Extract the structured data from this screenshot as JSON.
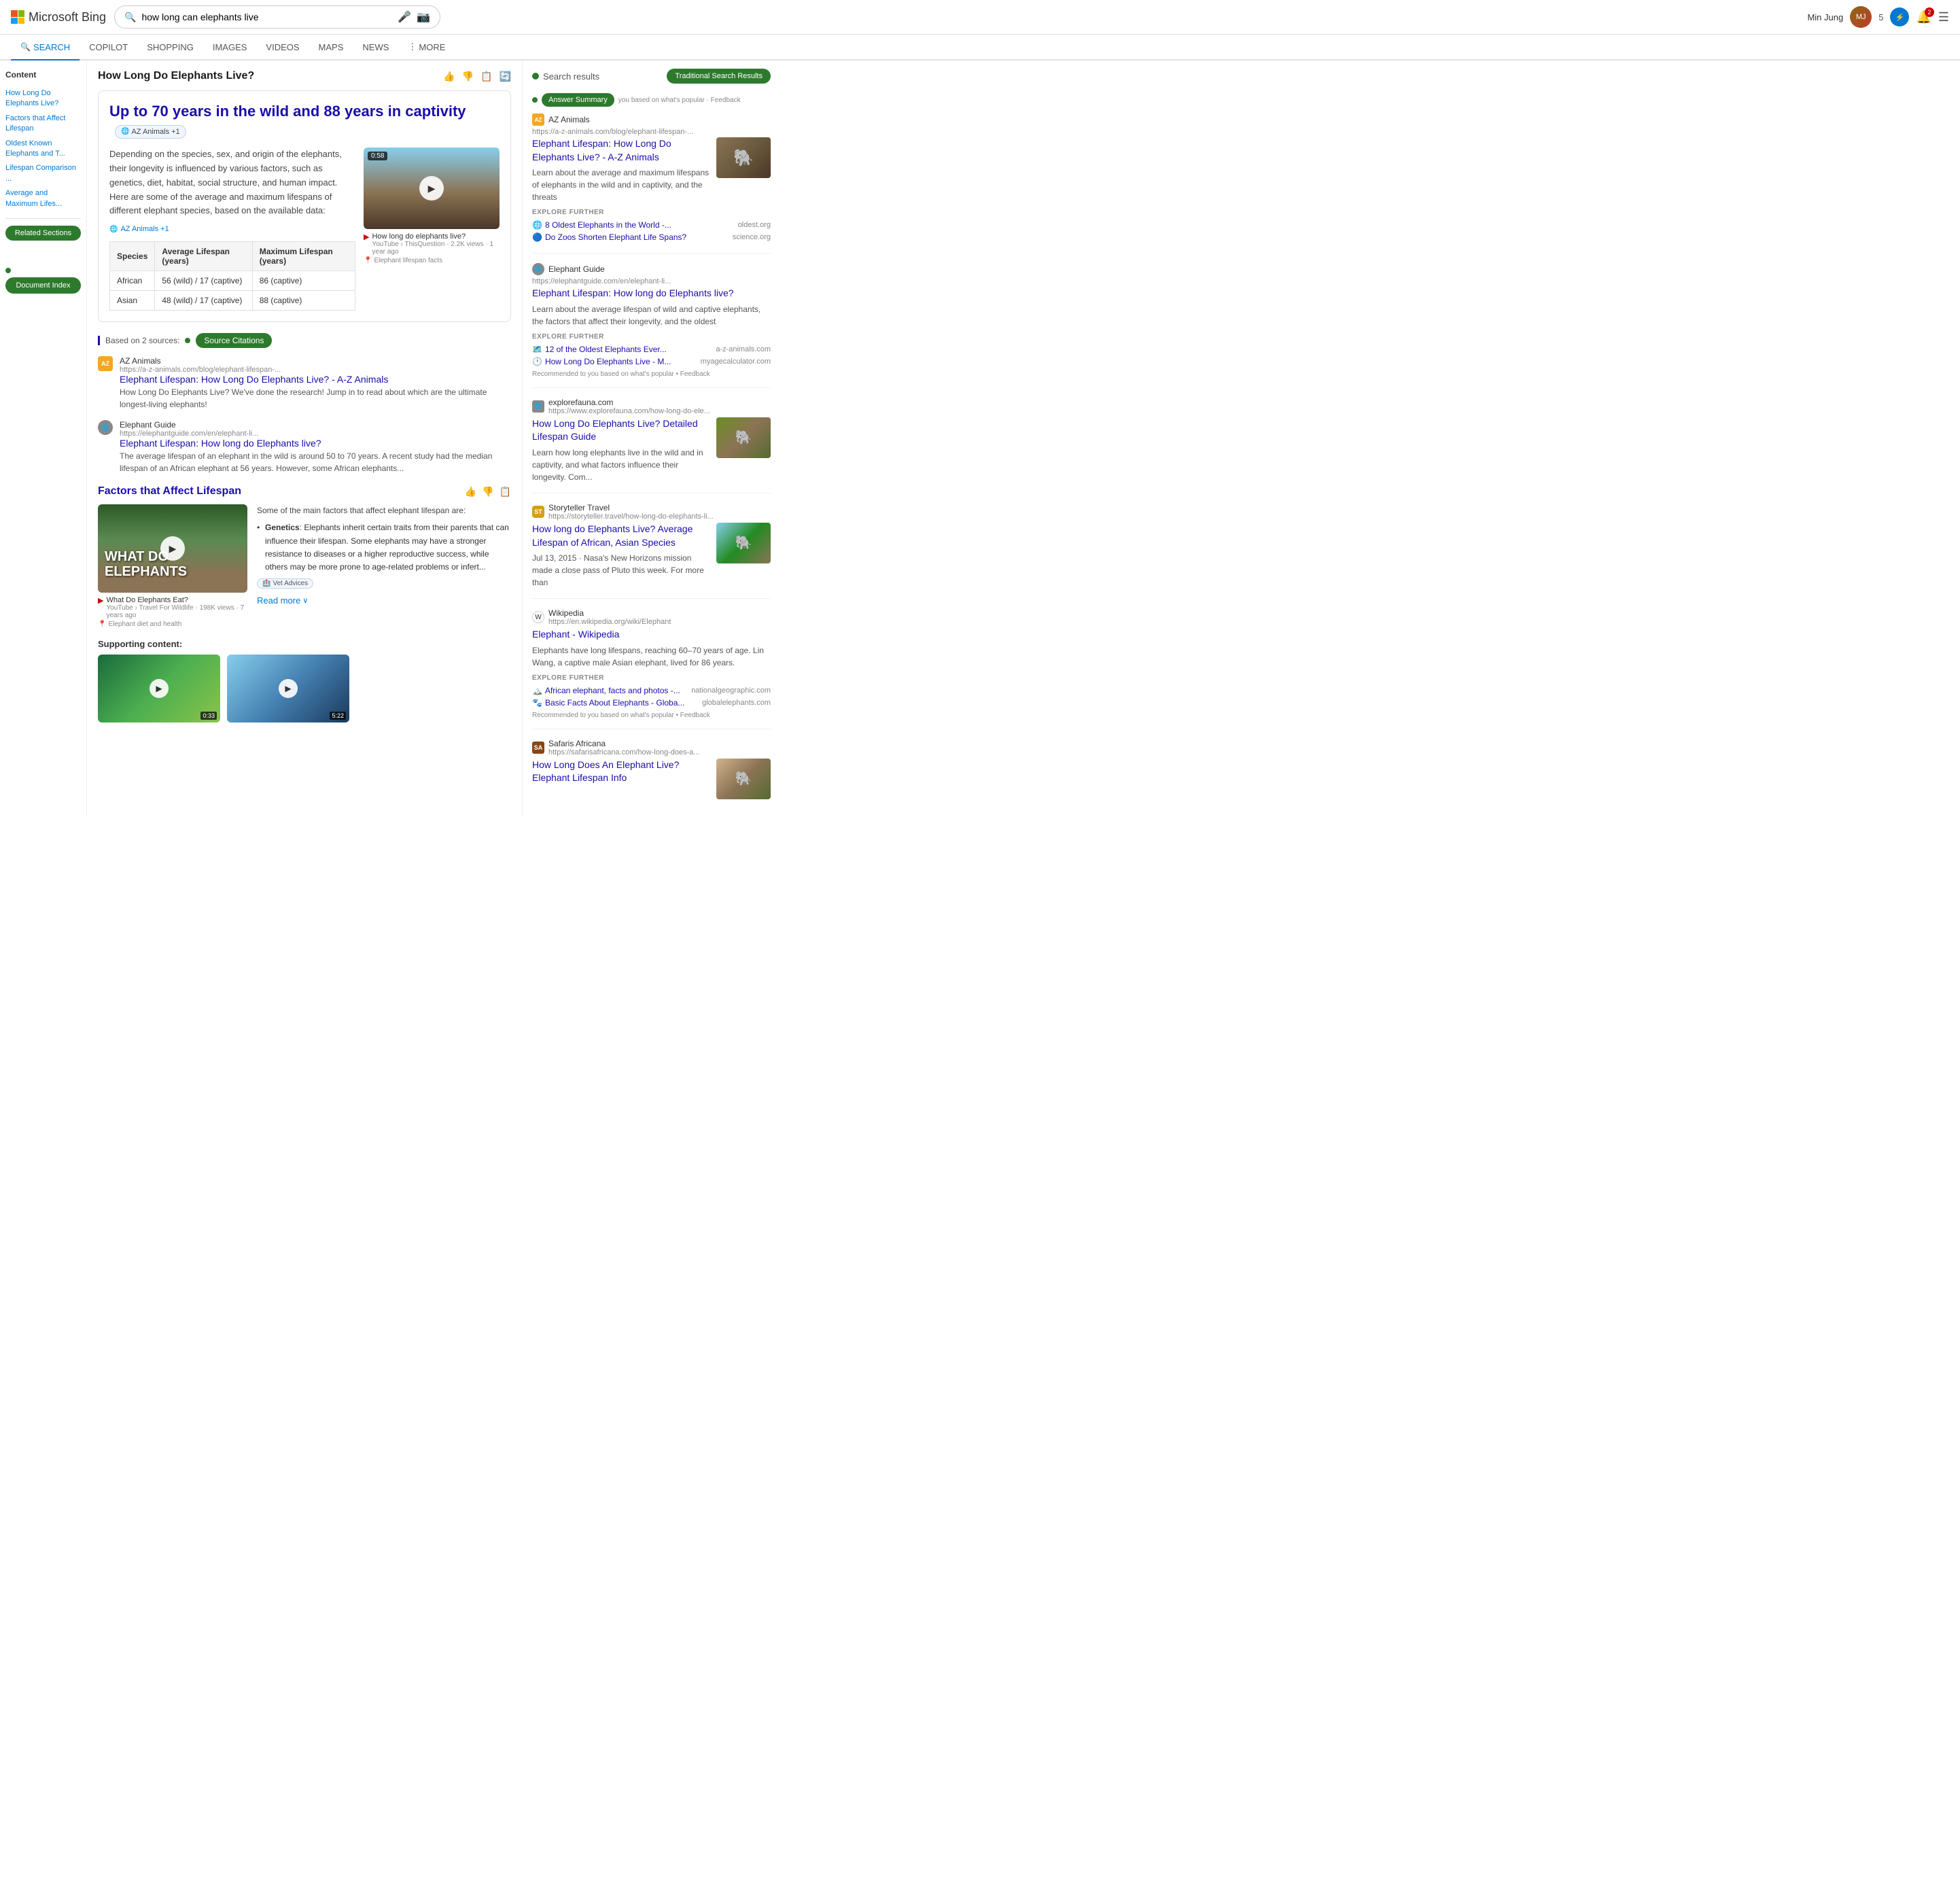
{
  "header": {
    "logo_text": "Microsoft Bing",
    "search_query": "how long can elephants live",
    "user_name": "Min Jung",
    "user_points": "5",
    "notif_count": "2"
  },
  "nav": {
    "tabs": [
      {
        "id": "search",
        "label": "SEARCH",
        "active": true
      },
      {
        "id": "copilot",
        "label": "COPILOT",
        "active": false
      },
      {
        "id": "shopping",
        "label": "SHOPPING",
        "active": false
      },
      {
        "id": "images",
        "label": "IMAGES",
        "active": false
      },
      {
        "id": "videos",
        "label": "VIDEOS",
        "active": false
      },
      {
        "id": "maps",
        "label": "MAPS",
        "active": false
      },
      {
        "id": "news",
        "label": "NEWS",
        "active": false
      },
      {
        "id": "more",
        "label": "MORE",
        "active": false
      }
    ]
  },
  "sidebar": {
    "title": "Content",
    "items": [
      {
        "label": "How Long Do Elephants Live?"
      },
      {
        "label": "Factors that Affect Lifespan"
      },
      {
        "label": "Oldest Known Elephants and T..."
      },
      {
        "label": "Lifespan Comparison ..."
      },
      {
        "label": "Average and Maximum Lifes..."
      }
    ],
    "doc_index_btn": "Document Index"
  },
  "main": {
    "page_title": "How Long Do Elephants Live?",
    "answer_headline": "Up to 70 years in the wild and 88 years in captivity",
    "source_badge": "AZ Animals +1",
    "answer_body_text": "Depending on the species, sex, and origin of the elephants, their longevity is influenced by various factors, such as genetics, diet, habitat, social structure, and human impact. Here are some of the average and maximum lifespans of different elephant species, based on the available data:",
    "answer_source_link": "AZ Animals +1",
    "video": {
      "duration": "0:58",
      "title": "How long do elephants live?",
      "channel": "YouTube › ThisQuestion",
      "views": "2.2K views",
      "time_ago": "1 year ago",
      "location_label": "Elephant lifespan facts"
    },
    "table": {
      "headers": [
        "Species",
        "Average Lifespan (years)",
        "Maximum Lifespan (years)"
      ],
      "rows": [
        [
          "African",
          "56 (wild) / 17 (captive)",
          "86 (captive)"
        ],
        [
          "Asian",
          "48 (wild) / 17 (captive)",
          "88 (captive)"
        ]
      ]
    },
    "sources_label": "Based on 2 sources:",
    "source_citations_btn": "Source Citations",
    "sources": [
      {
        "site": "AZ Animals",
        "url": "https://a-z-animals.com/blog/elephant-lifespan-...",
        "title": "Elephant Lifespan: How Long Do Elephants Live? - A-Z Animals",
        "desc": "How Long Do Elephants Live? We've done the research! Jump in to read about which are the ultimate longest-living elephants!"
      },
      {
        "site": "Elephant Guide",
        "url": "https://elephantguide.com/en/elephant-li...",
        "title": "Elephant Lifespan: How long do Elephants live?",
        "desc": "The average lifespan of an elephant in the wild is around 50 to 70 years. A recent study had the median lifespan of an African elephant at 56 years. However, some African elephants..."
      }
    ],
    "factors_section": {
      "title": "Factors that Affect Lifespan",
      "video": {
        "title": "WHAT DO ELEPHANTS",
        "subtitle": "What Do Elephants Eat?",
        "channel": "YouTube › Travel For Wildlife",
        "views": "198K views",
        "time_ago": "7 years ago",
        "location_label": "Elephant diet and health"
      },
      "intro": "Some of the main factors that affect elephant lifespan are:",
      "bullets": [
        {
          "term": "Genetics",
          "text": "Elephants inherit certain traits from their parents that can influence their lifespan. Some elephants may have a stronger resistance to diseases or a higher reproductive success, while others may be more prone to age-related problems or infert..."
        }
      ],
      "vet_badge": "Vet Advices",
      "read_more": "Read more"
    },
    "supporting_title": "Supporting content:",
    "mini_videos": [
      {
        "duration": "0:33"
      },
      {
        "duration": "5:22"
      }
    ]
  },
  "tsr": {
    "label": "Search results",
    "badge": "Traditional Search Results",
    "results": [
      {
        "site": "AZ Animals",
        "url": "https://a-z-animals.com/blog/elephant-lifespan-...",
        "title": "Elephant Lifespan: How Long Do Elephants Live? - A-Z Animals",
        "desc": "Learn about the average and maximum lifespans of elephants in the wild and in captivity, and the threats",
        "has_thumb": true,
        "explore_further": [
          {
            "label": "8 Oldest Elephants in the World -...",
            "source": "oldest.org",
            "icon": "globe"
          },
          {
            "label": "Do Zoos Shorten Elephant Life Spans?",
            "source": "science.org",
            "icon": "globe"
          }
        ],
        "feedback": "Recommended to you based on what's popular • Feedback"
      },
      {
        "site": "Elephant Guide",
        "url": "https://elephantguide.com/en/elephant-li...",
        "title": "Elephant Lifespan: How long do Elephants live?",
        "desc": "Learn about the average lifespan of wild and captive elephants, the factors that affect their longevity, and the oldest",
        "has_thumb": false,
        "explore_further": [
          {
            "label": "12 of the Oldest Elephants Ever...",
            "source": "a-z-animals.com",
            "icon": "map"
          },
          {
            "label": "How Long Do Elephants Live - M...",
            "source": "myagecalculator.com",
            "icon": "clock"
          }
        ],
        "feedback": "Recommended to you based on what's popular • Feedback"
      },
      {
        "site": "explorefauna.com",
        "url": "https://www.explorefauna.com/how-long-do-ele...",
        "title": "How Long Do Elephants Live? Detailed Lifespan Guide",
        "desc": "Learn how long elephants live in the wild and in captivity, and what factors influence their longevity. Com...",
        "has_thumb": true,
        "explore_further": [],
        "feedback": ""
      },
      {
        "site": "Storyteller Travel",
        "url": "https://storyteller.travel/how-long-do-elephants-li...",
        "title": "How long do Elephants Live? Average Lifespan of African, Asian Species",
        "desc": "Jul 13, 2015 · Nasa's New Horizons mission made a close pass of Pluto this week. For more than",
        "has_thumb": true,
        "explore_further": [],
        "feedback": ""
      },
      {
        "site": "Wikipedia",
        "url": "https://en.wikipedia.org/wiki/Elephant",
        "title": "Elephant - Wikipedia",
        "desc": "Elephants have long lifespans, reaching 60–70 years of age. Lin Wang, a captive male Asian elephant, lived for 86 years.",
        "has_thumb": false,
        "explore_further": [
          {
            "label": "African elephant, facts and photos -...",
            "source": "nationalgeographic.com",
            "icon": "flag"
          },
          {
            "label": "Basic Facts About Elephants - Globa...",
            "source": "globalelephants.com",
            "icon": "animal"
          }
        ],
        "feedback": "Recommended to you based on what's popular • Feedback"
      },
      {
        "site": "Safaris Africana",
        "url": "https://safarisafricana.com/how-long-does-a...",
        "title": "How Long Does An Elephant Live? Elephant Lifespan Info",
        "desc": "",
        "has_thumb": true,
        "explore_further": [],
        "feedback": ""
      }
    ]
  },
  "callouts": {
    "traditional_search_results": "Traditional Search Results",
    "answer_summary": "Answer Summary",
    "source_citations": "Source Citations",
    "related_sections": "Related Sections",
    "document_index": "Document Index"
  }
}
